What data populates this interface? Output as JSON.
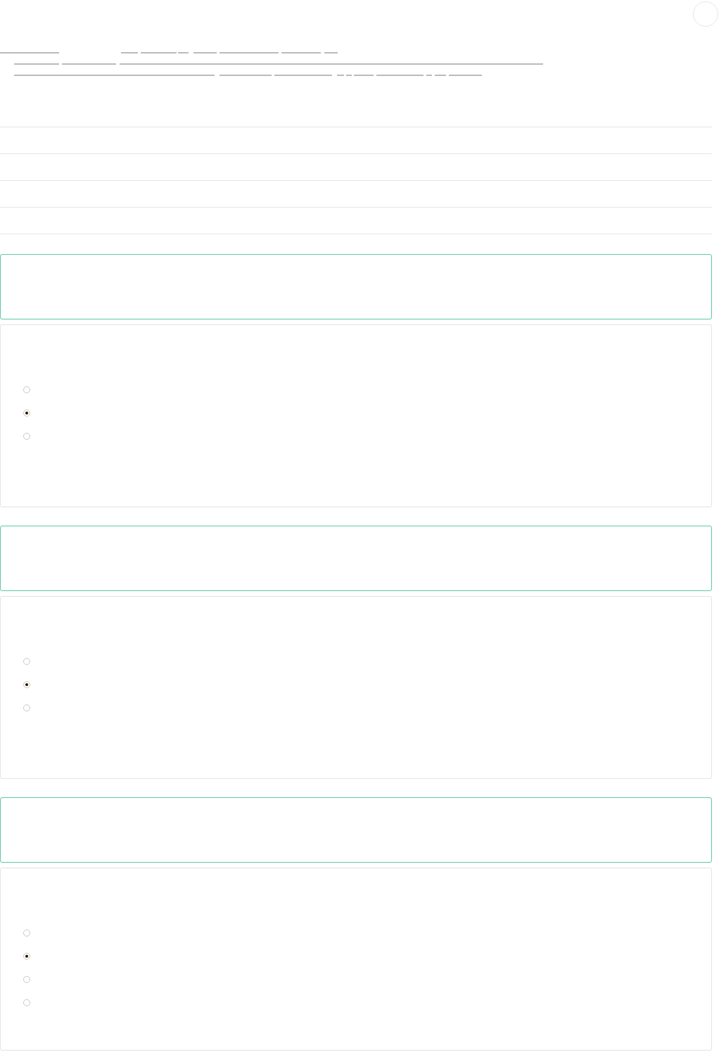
{
  "questions": [
    {
      "options": [
        {
          "selected": false
        },
        {
          "selected": true
        },
        {
          "selected": false
        }
      ]
    },
    {
      "options": [
        {
          "selected": false
        },
        {
          "selected": true
        },
        {
          "selected": false
        }
      ]
    },
    {
      "options": [
        {
          "selected": false
        },
        {
          "selected": true
        },
        {
          "selected": false
        },
        {
          "selected": false
        }
      ]
    }
  ]
}
